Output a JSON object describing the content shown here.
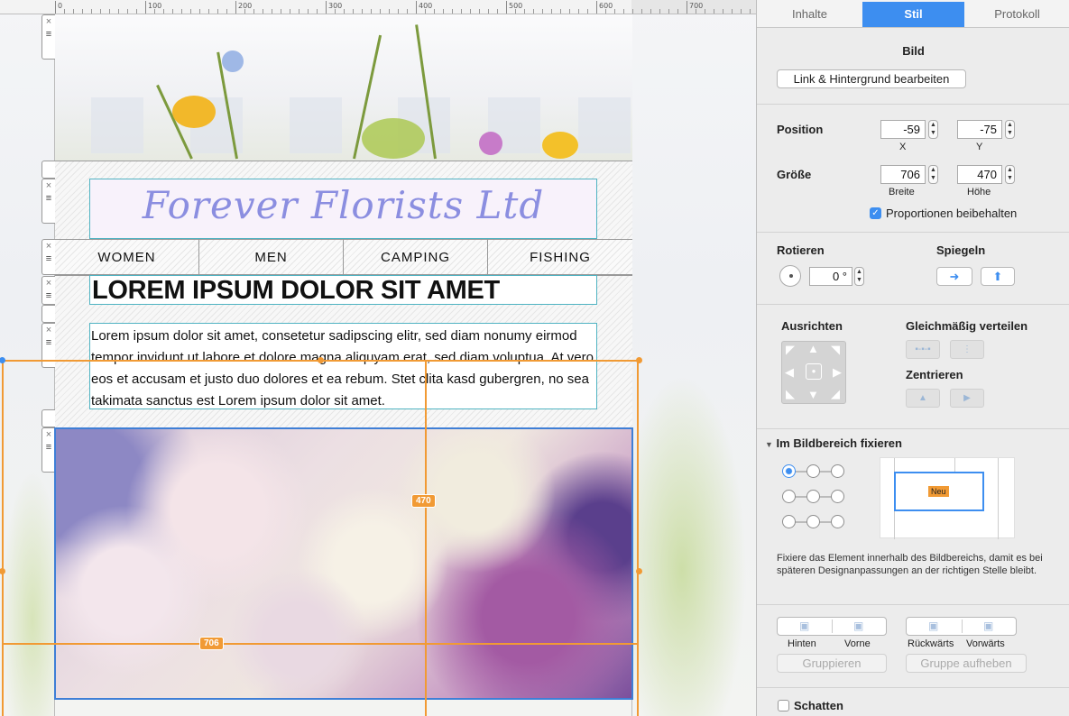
{
  "ruler": {
    "labels": [
      "0",
      "100",
      "200",
      "300",
      "400",
      "500",
      "600",
      "700"
    ]
  },
  "site": {
    "title": "Forever Florists Ltd",
    "nav": [
      "WOMEN",
      "MEN",
      "CAMPING",
      "FISHING"
    ],
    "headline": "LOREM IPSUM DOLOR SIT AMET",
    "body": "Lorem ipsum dolor sit amet, consetetur sadipscing elitr, sed diam nonumy eirmod tempor invidunt ut labore et dolore magna aliquyam erat, sed diam voluptua. At vero eos et accusam et justo duo dolores et ea rebum. Stet clita kasd gubergren, no sea takimata sanctus est Lorem ipsum dolor sit amet."
  },
  "selection": {
    "height_label": "470",
    "width_label": "706"
  },
  "inspector": {
    "tabs": [
      "Inhalte",
      "Stil",
      "Protokoll"
    ],
    "active_tab": "Stil",
    "section_title": "Bild",
    "link_button": "Link & Hintergrund bearbeiten",
    "position": {
      "label": "Position",
      "x": "-59",
      "y": "-75",
      "x_label": "X",
      "y_label": "Y"
    },
    "size": {
      "label": "Größe",
      "width": "706",
      "height": "470",
      "width_label": "Breite",
      "height_label": "Höhe"
    },
    "proportions": "Proportionen beibehalten",
    "rotate": {
      "label": "Rotieren",
      "value": "0 °"
    },
    "mirror": {
      "label": "Spiegeln"
    },
    "align": {
      "label": "Ausrichten",
      "distribute": "Gleichmäßig verteilen",
      "center": "Zentrieren"
    },
    "fix": {
      "label": "Im Bildbereich fixieren",
      "new_badge": "Neu",
      "description": "Fixiere das Element innerhalb des Bildbereichs, damit es bei späteren Designanpassungen an der richtigen Stelle bleibt."
    },
    "arrange": {
      "back": "Hinten",
      "front": "Vorne",
      "backward": "Rückwärts",
      "forward": "Vorwärts",
      "group": "Gruppieren",
      "ungroup": "Gruppe aufheben"
    },
    "shadow": "Schatten"
  },
  "colors": {
    "accent": "#3d8ef0",
    "selection": "#f19a34",
    "title_script": "#8b8ee0"
  }
}
